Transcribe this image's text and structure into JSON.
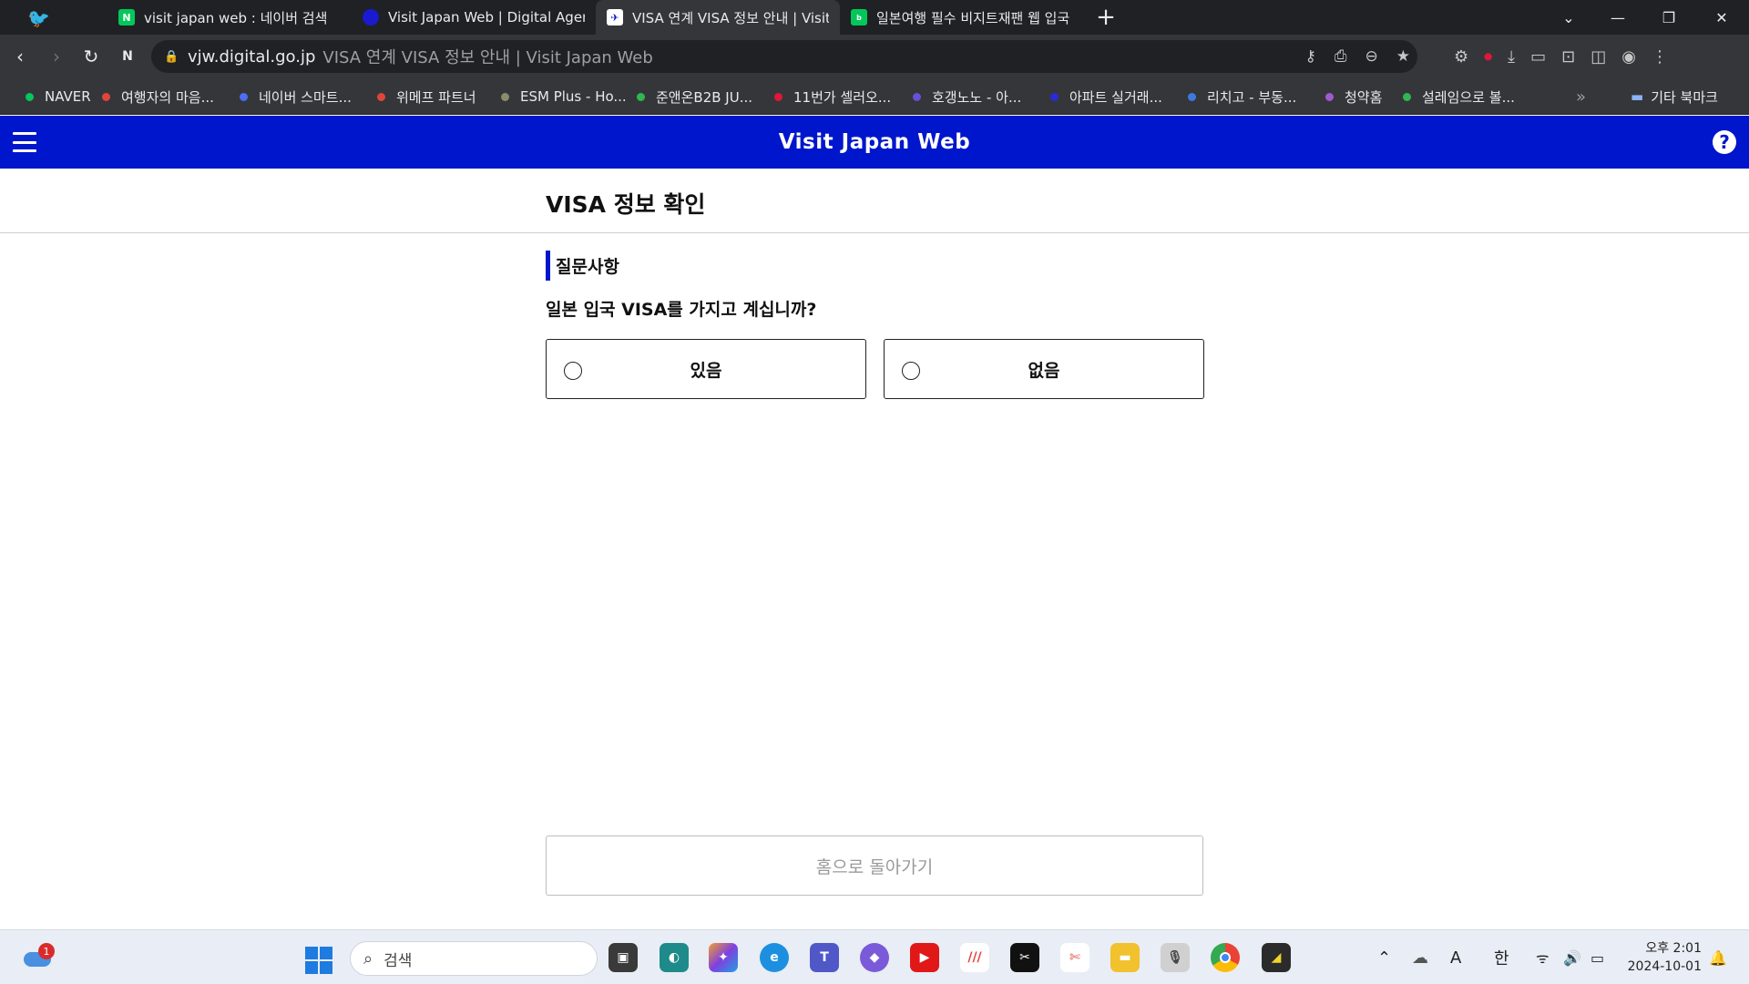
{
  "browser": {
    "tabs": [
      {
        "title": "visit japan web : 네이버 검색",
        "favicon": "naver-icon",
        "color": "#03c75a",
        "glyph": "N"
      },
      {
        "title": "Visit Japan Web | Digital Agency",
        "favicon": "digital-agency-icon",
        "color": "#1a1ad1",
        "glyph": ""
      },
      {
        "title": "VISA 연계 VISA 정보 안내 | Visit Japan Web",
        "favicon": "visit-japan-icon",
        "color": "#ffffff",
        "glyph": "✈"
      },
      {
        "title": "일본여행 필수 비지트재팬 웹 입국",
        "favicon": "naver-blog-icon",
        "color": "#03c75a",
        "glyph": "b"
      }
    ],
    "new_tab_label": "+",
    "address": {
      "host": "vjw.digital.go.jp",
      "title": "VISA 연계 VISA 정보 안내 | Visit Japan Web"
    },
    "bookmarks": [
      {
        "label": "NAVER",
        "color": "#03c75a"
      },
      {
        "label": "여행자의 마음...",
        "color": "#e0453a"
      },
      {
        "label": "네이버 스마트...",
        "color": "#4c6ef5"
      },
      {
        "label": "위메프 파트너",
        "color": "#e0453a"
      },
      {
        "label": "ESM Plus - Ho...",
        "color": "#8c8c6a"
      },
      {
        "label": "준앤온B2B JU...",
        "color": "#2fb84f"
      },
      {
        "label": "11번가 셀러오...",
        "color": "#e0173a"
      },
      {
        "label": "호갱노노 - 아...",
        "color": "#6a4fd8"
      },
      {
        "label": "아파트 실거래...",
        "color": "#2a2ad8"
      },
      {
        "label": "리치고 - 부동...",
        "color": "#3b7be0"
      },
      {
        "label": "청약홈",
        "color": "#a05ad0"
      },
      {
        "label": "설레임으로 볼...",
        "color": "#2fb84f"
      }
    ],
    "more_bookmarks": "»",
    "other_bookmarks": "기타 북마크"
  },
  "site": {
    "title": "Visit Japan Web",
    "help": "?"
  },
  "page": {
    "title": "VISA 정보 확인",
    "section_title": "질문사항",
    "question": "일본 입국 VISA를 가지고 계십니까?",
    "options": [
      {
        "label": "있음",
        "selected": false
      },
      {
        "label": "없음",
        "selected": false
      }
    ],
    "home_button": "홈으로 돌아가기"
  },
  "taskbar": {
    "weather_badge": "1",
    "search_placeholder": "검색",
    "ime": "한",
    "ime_mode": "A",
    "time": "오후 2:01",
    "date": "2024-10-01"
  },
  "colors": {
    "brand_blue": "#0016cc",
    "chrome_dark": "#202124",
    "chrome_mid": "#35363a"
  }
}
